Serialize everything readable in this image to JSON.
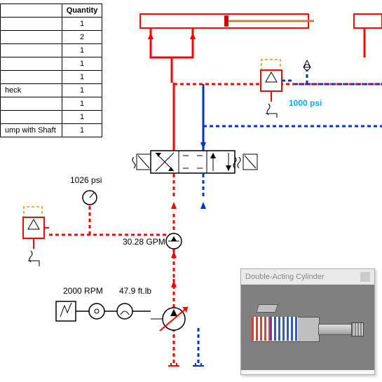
{
  "table": {
    "header": "Quantity",
    "rows": [
      {
        "label": "",
        "qty": "1"
      },
      {
        "label": "",
        "qty": "2"
      },
      {
        "label": "",
        "qty": "1"
      },
      {
        "label": "",
        "qty": "1"
      },
      {
        "label": "",
        "qty": "1"
      },
      {
        "label": "heck",
        "qty": "1"
      },
      {
        "label": "",
        "qty": "1"
      },
      {
        "label": "",
        "qty": "1"
      },
      {
        "label": "ump with Shaft",
        "qty": "1"
      }
    ]
  },
  "labels": {
    "pressure_gauge": "1026 psi",
    "flow": "30.28 GPM",
    "rpm": "2000 RPM",
    "torque": "47.9 ft.lb",
    "relief_pressure": "1000 psi"
  },
  "popup": {
    "title": "Double-Acting Cylinder"
  },
  "components": {
    "motor": "electric-motor",
    "pump": "variable-pump",
    "gauge": "pressure-gauge",
    "flow_meter": "flow-meter",
    "relief_left": "pressure-relief-valve",
    "relief_right": "pressure-relief-valve",
    "dcv": "4-3-directional-valve",
    "cyl_left": "double-acting-cylinder",
    "cyl_right": "double-acting-cylinder"
  },
  "colors": {
    "pressure": "#ff0000",
    "return": "#0033cc",
    "pilot": "#d0b000"
  }
}
